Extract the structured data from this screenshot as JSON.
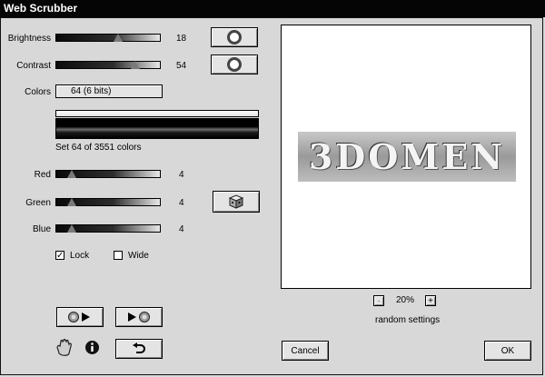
{
  "window": {
    "title": "Web Scrubber"
  },
  "sliders": {
    "brightness": {
      "label": "Brightness",
      "value": "18",
      "level": 0.6
    },
    "contrast": {
      "label": "Contrast",
      "value": "54",
      "level": 0.76
    },
    "red": {
      "label": "Red",
      "value": "4",
      "level": 0.15
    },
    "green": {
      "label": "Green",
      "value": "4",
      "level": 0.15
    },
    "blue": {
      "label": "Blue",
      "value": "4",
      "level": 0.15
    }
  },
  "colors": {
    "label": "Colors",
    "selected": "64 (6 bits)",
    "status": "Set 64 of 3551 colors"
  },
  "options": {
    "lock_label": "Lock",
    "lock_checked": true,
    "wide_label": "Wide",
    "wide_checked": false
  },
  "preview": {
    "banner_text": "3DOMEN",
    "zoom": "20%",
    "zoom_minus": "-",
    "zoom_plus": "+",
    "caption": "random settings"
  },
  "buttons": {
    "cancel": "Cancel",
    "ok": "OK"
  },
  "icons": {
    "reset_brightness": "ring-icon",
    "reset_contrast": "ring-icon",
    "random": "dice-icon",
    "play_back": "play-back-icon",
    "play_forward": "play-forward-icon",
    "hand": "hand-icon",
    "info": "info-icon",
    "undo": "undo-icon"
  }
}
